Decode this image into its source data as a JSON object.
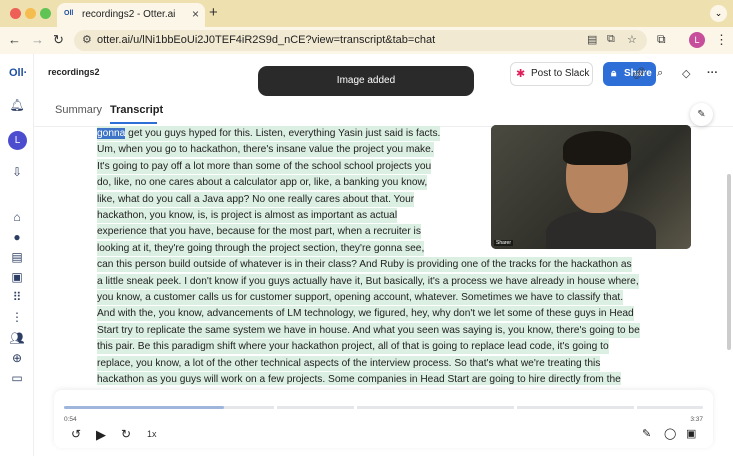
{
  "browser": {
    "tab_title": "recordings2 - Otter.ai",
    "tab_favicon": "Oll",
    "url": "otter.ai/u/lNi1bbEoUi2J0TEF4iR2S9d_nCE?view=transcript&tab=chat",
    "profile_initial": "L"
  },
  "app": {
    "file_name": "recordings2",
    "toast": "Image added",
    "slack_button": "Post to Slack",
    "share_button": "Share",
    "avatar_initial": "L"
  },
  "tabs": {
    "summary": "Summary",
    "transcript": "Transcript"
  },
  "transcript": {
    "selected_word": "gonna",
    "first_line_rest": " get you guys hyped for this. Listen, everything Yasin just said is facts.",
    "lines": [
      "Um, when you go to hackathon, there's insane value the project you make.",
      "It's going to pay off a lot more than some of the school school projects you",
      "do, like, no one cares about a calculator app or, like, a banking you know,",
      "like, what do you call a Java app? No one really cares about that. Your",
      "hackathon, you know, is, is project is almost as important as actual",
      "experience that you have, because for the most part, when a recruiter is",
      "looking at it, they're going through the project section, they're gonna see,",
      "can this person build outside of whatever is in their class? And Ruby is providing one of the tracks for the hackathon as",
      "a little sneak peek. I don't know if you guys actually have it, But basically, it's a process we have already in house where,",
      "you know, a customer calls us for customer support, opening account, whatever. Sometimes we have to classify that.",
      "And with the, you know, advancements of LM technology, we figured, hey, why don't we let some of these guys in Head",
      "Start try to replicate the same system we have in house. And what you seen was saying is, you know, there's going to be",
      "this pair. Be this paradigm shift where your hackathon project, all of that is going to replace lead code, it's going to",
      "replace, you know, a lot of the other technical aspects of the interview process. So that's what we're treating this",
      "hackathon as you guys will work on a few projects. Some companies in Head Start are going to hire directly from the"
    ]
  },
  "video": {
    "label": "Sharer"
  },
  "player": {
    "current_time": "0:54",
    "total_time": "3:37",
    "speed": "1x",
    "progress_fraction": 0.25
  },
  "colors": {
    "accent": "#2d6fd7",
    "highlight": "#dcefe3",
    "selection": "#3e74c7"
  }
}
